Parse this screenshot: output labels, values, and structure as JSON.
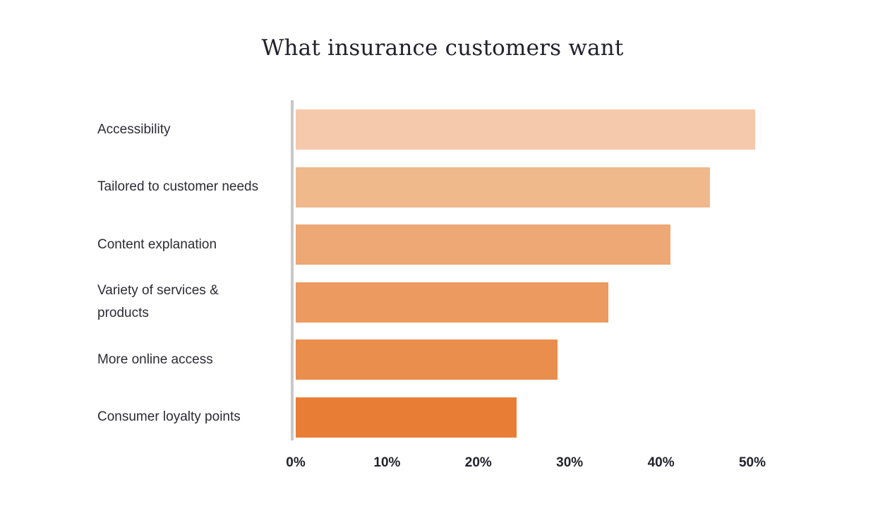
{
  "chart_data": {
    "type": "bar",
    "orientation": "horizontal",
    "title": "What insurance customers want",
    "xlabel": "",
    "ylabel": "",
    "xlim": [
      0,
      52
    ],
    "grid": false,
    "legend": false,
    "categories": [
      "Accessibility",
      "Tailored to customer needs",
      "Content explanation",
      "Variety of services & products",
      "More online access",
      "Consumer loyalty points"
    ],
    "values": [
      50.3,
      45.4,
      41.0,
      34.2,
      28.7,
      24.2
    ],
    "bar_colors": [
      "#f5c9ab",
      "#f0b98c",
      "#eda875",
      "#ec9a5f",
      "#e98e4d",
      "#e87e35"
    ],
    "tick_labels": [
      "0%",
      "10%",
      "20%",
      "30%",
      "40%",
      "50%"
    ],
    "tick_values": [
      0,
      10,
      20,
      30,
      40,
      50
    ]
  },
  "style": {
    "background": "#ffffff",
    "title_color": "#22222c",
    "label_color": "#2b2b33",
    "axis_color": "#c8c8c8"
  }
}
